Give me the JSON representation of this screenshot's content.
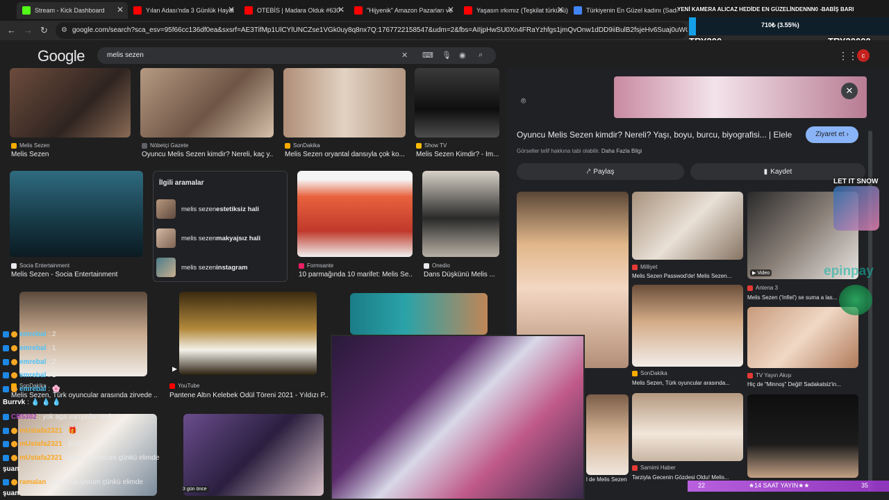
{
  "tabs": [
    {
      "label": "Stream - Kick Dashboard",
      "color": "#53fc18"
    },
    {
      "label": "Yılan Adası'nda 3 Günlük Hayat",
      "color": "#ff0000"
    },
    {
      "label": "OTEBİS | Madara Olduk #630 -",
      "color": "#ff0000"
    },
    {
      "label": "\"Hijyenik\" Amazon Pazarları ve",
      "color": "#ff0000"
    },
    {
      "label": "Yaşasın ırkımız (Teşkilat türküsü)",
      "color": "#ff0000"
    },
    {
      "label": "Türkiyenin En Güzel kadını (Sadı",
      "color": "#4285f4"
    }
  ],
  "url": "google.com/search?sca_esv=95f66cc136df0ea&sxsrf=AE3TifMp1UlCYlUNCZse1VGk0uy8q8nx7Q:1767722158547&udm=2&fbs=AIIjpHwSU0Xn4FRaYzhfgs1jmQvOnw1dDD9iiBulB2fsjeHv6Suaj0uWGr65idqq_D8h15...",
  "overlay": {
    "ticker": "YENİ KAMERA ALICAZ HEDİDE EN GÜZELİNDENNN0 -BABİŞ BARI",
    "donation_progress": "710₺ (3.55%)",
    "progress_fraction": 0.0355,
    "min_label": "TRY200",
    "max_label": "TRY20000",
    "let_it_snow": "LET IT SNOW",
    "papara": "epinpay",
    "bottom_banner": "★14 SAAT YAYIN★★",
    "bottom_left_num": "22",
    "bottom_right_num": "35"
  },
  "google": {
    "logo": "Google",
    "query": "melis sezen",
    "avatar": "c"
  },
  "results": [
    {
      "source": "Melis Sezen",
      "title": "Melis Sezen",
      "src_color": "#f9ab00"
    },
    {
      "source": "Nöbetçi Gazete",
      "title": "Oyuncu Melis Sezen kimdir? Nereli, kaç y...",
      "src_color": "#5f6368"
    },
    {
      "source": "SonDakika",
      "title": "Melis Sezen oryantal dansıyla çok ko...",
      "src_color": "#f9ab00"
    },
    {
      "source": "Show TV",
      "title": "Melis Sezen Kimdir? - İm...",
      "src_color": "#fbbc04"
    },
    {
      "source": "Socia Entertainment",
      "title": "Melis Sezen - Socia Entertainment",
      "src_color": "#e8eaed"
    },
    {
      "source": "Formsante",
      "title": "10 parmağında 10 marifet: Melis Se...",
      "src_color": "#e91e63"
    },
    {
      "source": "Onedio",
      "title": "Dans Düşkünü Melis ...",
      "src_color": "#e8eaed"
    },
    {
      "source": "SonDakika",
      "title": "Melis Sezen, Türk oyuncular arasında zirvede ...",
      "src_color": "#f9ab00"
    },
    {
      "source": "YouTube",
      "title": "Pantene Altın Kelebek Ödül Töreni 2021 - Yıldızı P...",
      "src_color": "#ff0000"
    },
    {
      "badge": "3 gün önce"
    }
  ],
  "related": {
    "heading": "İlgili aramalar",
    "items": [
      {
        "prefix": "melis sezen ",
        "bold": "estetiksiz hali"
      },
      {
        "prefix": "melis sezen ",
        "bold": "makyajsız hali"
      },
      {
        "prefix": "melis sezen ",
        "bold": "instagram"
      }
    ]
  },
  "panel": {
    "title": "Oyuncu Melis Sezen kimdir? Nereli? Yaşı, boyu, burcu, biyografisi... | Elele",
    "visit": "Ziyaret et",
    "copyright": "Görseller telif hakkına tabi olabilir.",
    "more_info": "Daha Fazla Bilgi",
    "share": "Paylaş",
    "save": "Kaydet",
    "related": [
      {
        "source": "Milliyet",
        "title": "Melis Sezen Passwod'de! Melis Sezen...",
        "color": "#e53935"
      },
      {
        "source": "Antena 3",
        "title": "Melis Sezen ('Infiel') se suma a las...",
        "color": "#e53935"
      },
      {
        "source": "SonDakika",
        "title": "Melis Sezen, Türk oyuncular arasında...",
        "color": "#f9ab00"
      },
      {
        "source": "TV Yayın Akışı",
        "title": "Hiç de \"Minnoş\" Değil! Sadakatsiz'in...",
        "color": "#e53935"
      },
      {
        "source": "Samimi Haber",
        "title": "Tarziyla Gecenin Gözdesi Oldu! Melis...",
        "color": "#e53935"
      },
      {
        "title": "l de Melis Sezen"
      }
    ],
    "video": "Video"
  },
  "chat": [
    {
      "user": "emrebal",
      "msg": ": 2",
      "color": "#4fc3f7"
    },
    {
      "user": "emrebal",
      "msg": ": 1",
      "color": "#4fc3f7"
    },
    {
      "user": "emrebal",
      "msg": ": 2",
      "color": "#4fc3f7"
    },
    {
      "user": "emrebal",
      "msg": ": 1",
      "color": "#4fc3f7"
    },
    {
      "user": "emrebal",
      "msg": ": 🌸",
      "color": "#4fc3f7"
    },
    {
      "user": "Burrvk",
      "msg": ": 💧 💧 💧",
      "color": "#ffffff"
    },
    {
      "user": "CB5302",
      "msg": ": yok aga sarışınlar önde",
      "color": "#ab47bc"
    },
    {
      "user": "mUstafa2321",
      "msg": ": 🎁",
      "color": "#f9a825"
    },
    {
      "user": "mUstafa2321",
      "msg": ": EVET",
      "color": "#f9a825"
    },
    {
      "user": "mUstafa2321",
      "msg": ": bunu tutuyorum çünkü elimde",
      "color": "#f9a825"
    },
    {
      "user": "şuan",
      "msg": "",
      "color": "#ffffff"
    },
    {
      "user": "ramalan",
      "msg": ": bunu tutuyorum çünkü elimde",
      "color": "#f9a825"
    },
    {
      "user": "şuan",
      "msg": "",
      "color": "#ffffff"
    }
  ]
}
